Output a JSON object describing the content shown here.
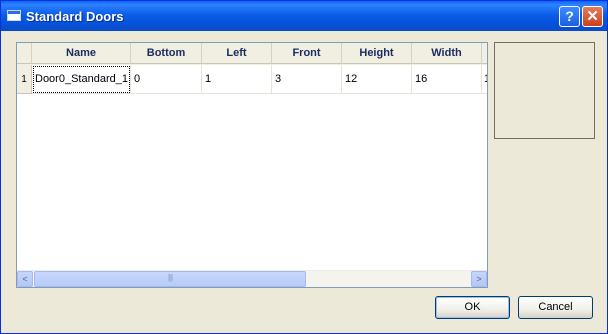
{
  "window": {
    "title": "Standard Doors",
    "help_glyph": "?",
    "close_glyph": "✕"
  },
  "table": {
    "columns": [
      "Name",
      "Bottom",
      "Left",
      "Front",
      "Height",
      "Width"
    ],
    "rows": [
      {
        "index": "1",
        "cells": [
          "Door0_Standard_1",
          "0",
          "1",
          "3",
          "12",
          "16"
        ],
        "overflow_glyph": "1"
      }
    ]
  },
  "scrollbar": {
    "left_arrow": "<",
    "right_arrow": ">",
    "thumb_grip": "||||"
  },
  "buttons": {
    "ok": "OK",
    "cancel": "Cancel"
  }
}
